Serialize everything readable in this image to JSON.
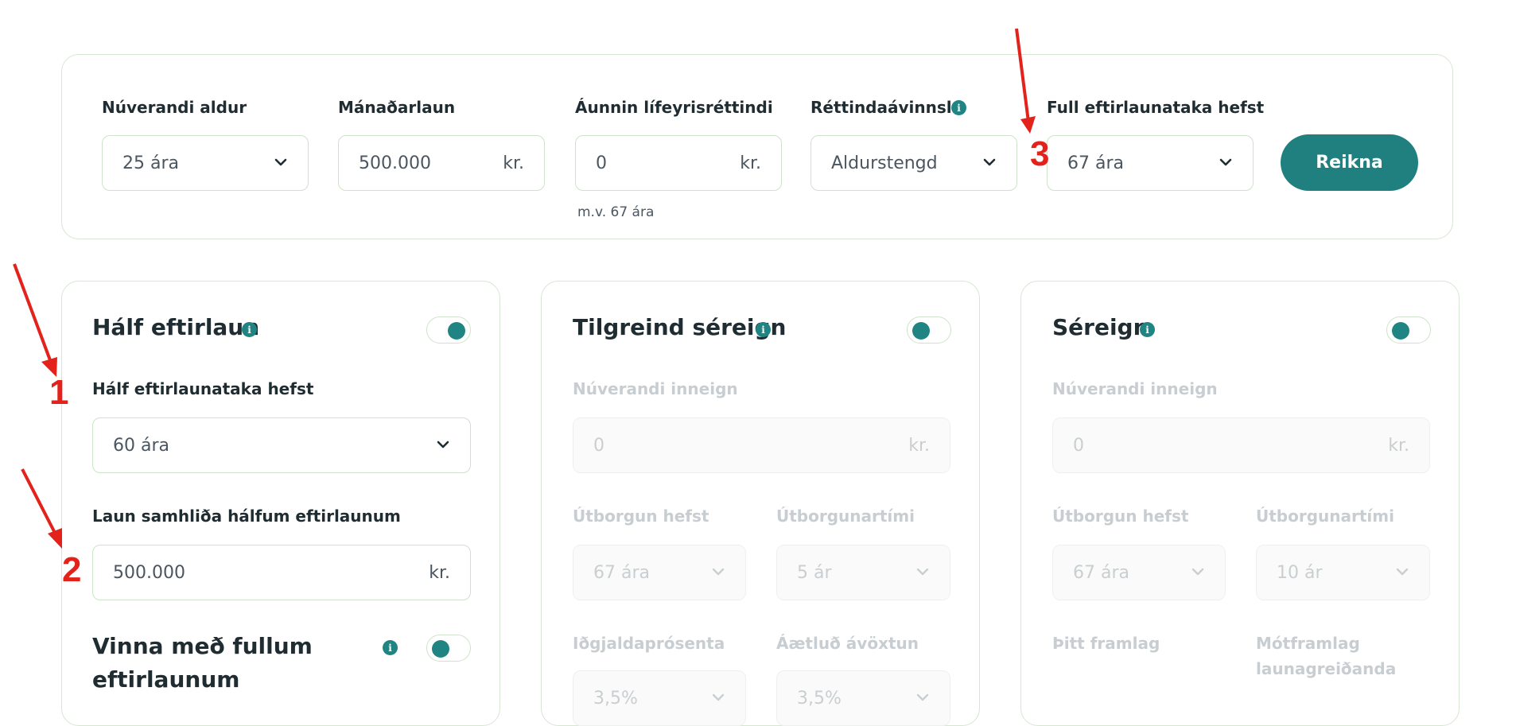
{
  "top": {
    "age": {
      "label": "Núverandi aldur",
      "value": "25 ára"
    },
    "salary": {
      "label": "Mánaðarlaun",
      "value": "500.000",
      "unit": "kr."
    },
    "earned": {
      "label": "Áunnin lífeyrisréttindi",
      "value": "0",
      "unit": "kr.",
      "note": "m.v. 67 ára"
    },
    "accrual": {
      "label": "Réttindaávinnsla",
      "value": "Aldurstengd"
    },
    "full_start": {
      "label": "Full eftirlaunataka hefst",
      "value": "67 ára"
    },
    "calc_button": "Reikna"
  },
  "card_half": {
    "title": "Hálf eftirlaun",
    "toggle_on": true,
    "start_label": "Hálf eftirlaunataka hefst",
    "start_value": "60 ára",
    "salary_label": "Laun samhliða hálfum eftirlaunum",
    "salary_value": "500.000",
    "salary_unit": "kr.",
    "work_title_line1": "Vinna með fullum",
    "work_title_line2": "eftirlaunum",
    "work_toggle_on": false
  },
  "card_specified": {
    "title": "Tilgreind séreign",
    "toggle_on": false,
    "balance_label": "Núverandi inneign",
    "balance_value": "0",
    "balance_unit": "kr.",
    "payout_start_label": "Útborgun hefst",
    "payout_start_value": "67 ára",
    "payout_time_label": "Útborgunartími",
    "payout_time_value": "5 ár",
    "premium_label": "Iðgjaldaprósenta",
    "premium_value": "3,5%",
    "return_label": "Áætluð ávöxtun",
    "return_value": "3,5%"
  },
  "card_private": {
    "title": "Séreign",
    "toggle_on": false,
    "balance_label": "Núverandi inneign",
    "balance_value": "0",
    "balance_unit": "kr.",
    "payout_start_label": "Útborgun hefst",
    "payout_start_value": "67 ára",
    "payout_time_label": "Útborgunartími",
    "payout_time_value": "10 ár",
    "own_label": "Þitt framlag",
    "employer_label_line1": "Mótframlag",
    "employer_label_line2": "launagreiðanda"
  },
  "annotations": {
    "n1": "1",
    "n2": "2",
    "n3": "3"
  },
  "colors": {
    "accent": "#207f7f",
    "arrow": "#e3231b",
    "border": "#d7e6d3"
  }
}
